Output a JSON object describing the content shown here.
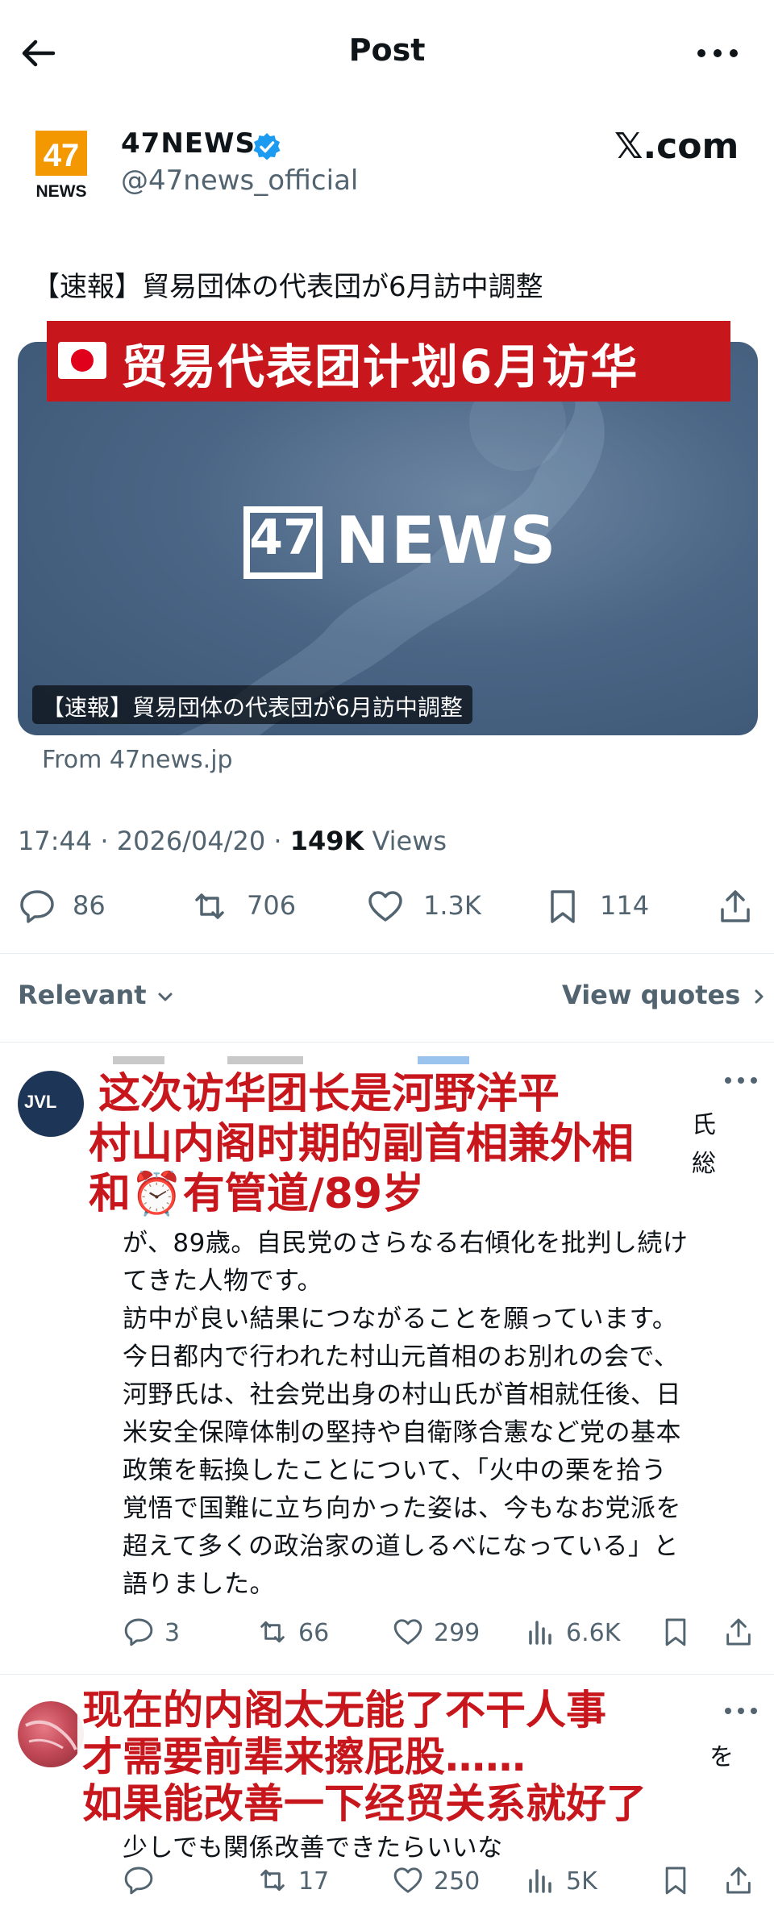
{
  "header": {
    "title": "Post",
    "back_icon": "arrow-left-icon",
    "more_icon": "more-horizontal-icon"
  },
  "author": {
    "logo_number": "47",
    "logo_word": "NEWS",
    "name": "47NEWS",
    "handle": "@47news_official",
    "verified": true,
    "source_badge": "𝕏.com"
  },
  "post": {
    "text": "【速報】貿易団体の代表団が6月訪中調整",
    "media": {
      "banner": "贸易代表团计划6月访华",
      "logo_number": "47",
      "logo_word": "NEWS",
      "caption": "【速報】貿易団体の代表団が6月訪中調整",
      "background_color": "#4a6585",
      "banner_color": "#c8161d"
    },
    "from": "From 47news.jp",
    "time": "17:44 · 2026/04/20 · ",
    "views_count": "149K",
    "views_label": " Views"
  },
  "actions": {
    "replies": "86",
    "reposts": "706",
    "likes": "1.3K",
    "bookmarks": "114"
  },
  "filter": {
    "sort": "Relevant",
    "quotes": "View quotes"
  },
  "replies": [
    {
      "avatar_text": "JVL",
      "overlay_lines": [
        "这次访华团长是河野洋平",
        "村山内阁时期的副首相兼外相",
        "和⏰有管道/89岁"
      ],
      "edge_fragments": [
        "氏",
        "総"
      ],
      "lines": [
        "が、89歳。自民党のさらなる右傾化を批判し続け",
        "てきた人物です。",
        "訪中が良い結果につながることを願っています。",
        "今日都内で行われた村山元首相のお別れの会で、",
        "河野氏は、社会党出身の村山氏が首相就任後、日",
        "米安全保障体制の堅持や自衛隊合憲など党の基本",
        "政策を転換したことについて、「火中の栗を拾う",
        "覚悟で国難に立ち向かった姿は、今もなお党派を",
        "超えて多くの政治家の道しるべになっている」と",
        "語りました。"
      ],
      "stats": {
        "replies": "3",
        "reposts": "66",
        "likes": "299",
        "views": "6.6K"
      }
    },
    {
      "overlay_lines": [
        "现在的内阁太无能了不干人事",
        "才需要前辈来擦屁股……",
        "如果能改善一下经贸关系就好了"
      ],
      "edge_fragments": [
        "を"
      ],
      "lines": [
        "少しでも関係改善できたらいいな"
      ],
      "stats": {
        "replies": "",
        "reposts": "17",
        "likes": "250",
        "views": "5K"
      }
    }
  ],
  "colors": {
    "text": "#0f1419",
    "muted": "#536471",
    "verified": "#1d9bf0",
    "overlay_red": "#c8161d"
  }
}
